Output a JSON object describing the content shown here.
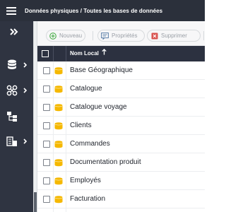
{
  "header": {
    "breadcrumb": "Données physiques / Toutes les bases de données",
    "menu_icon": "hamburger-menu-icon"
  },
  "sidebar": {
    "toggle_icon": "double-chevron-right-icon",
    "items": [
      {
        "icon": "database-icon"
      },
      {
        "icon": "network-nodes-icon"
      },
      {
        "icon": "hierarchy-blocks-icon"
      },
      {
        "icon": "building-layers-icon"
      }
    ]
  },
  "toolbar": {
    "add_label": "Nouveau",
    "properties_label": "Propriétés",
    "delete_label": "Supprimer"
  },
  "table": {
    "column_header": "Nom Local",
    "sort_direction": "ascending",
    "rows": [
      {
        "name": "Base Géographique"
      },
      {
        "name": "Catalogue"
      },
      {
        "name": "Catalogue voyage"
      },
      {
        "name": "Clients"
      },
      {
        "name": "Commandes"
      },
      {
        "name": "Documentation produit"
      },
      {
        "name": "Employés"
      },
      {
        "name": "Facturation"
      }
    ]
  },
  "colors": {
    "topbar": "#2b303b",
    "sidebar": "#2f3441",
    "table_header": "#2c3140",
    "db_icon": "#f5b800",
    "add_green": "#4cae4c",
    "delete_red": "#d9534f",
    "properties_blue": "#5b7fa8"
  }
}
